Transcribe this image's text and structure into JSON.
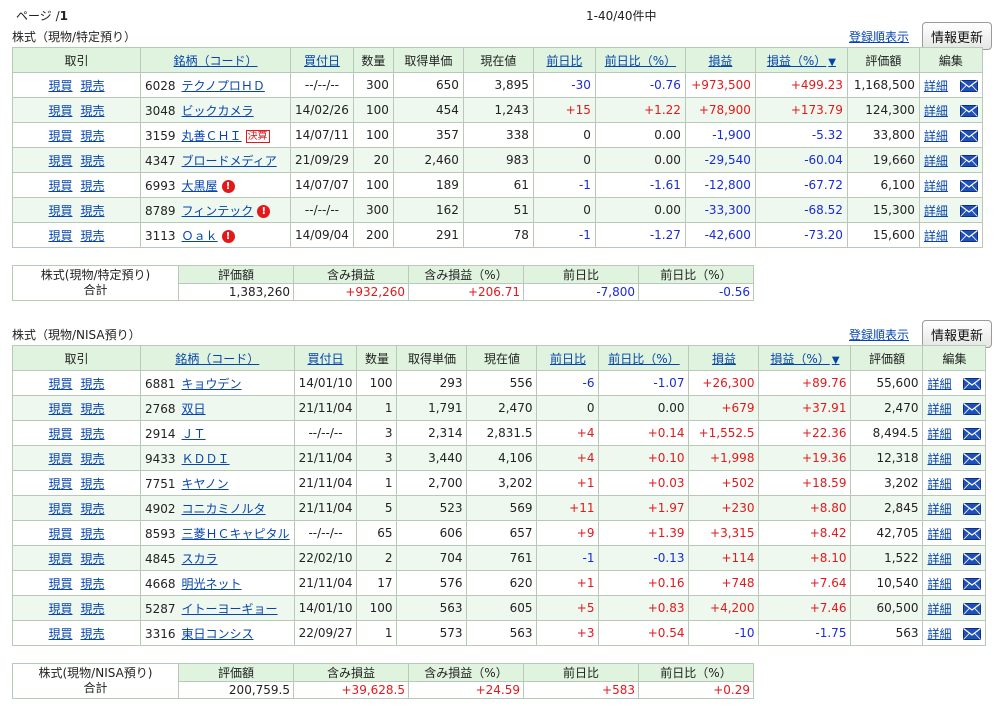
{
  "page": {
    "label": "ページ /",
    "number": "1"
  },
  "counter": "1-40/40件中",
  "header": {
    "trade": "取引",
    "name": "銘柄（コード）",
    "date": "買付日",
    "qty": "数量",
    "cost": "取得単価",
    "price": "現在値",
    "dayChange": "前日比",
    "dayChangePct": "前日比（%）",
    "pl": "損益",
    "plPct": "損益（%）",
    "plPctArrow": "▼",
    "value": "評価額",
    "edit": "編集"
  },
  "tradeLabels": {
    "buy": "現買",
    "sell": "現売"
  },
  "detailLabel": "詳細",
  "sortLinkLabel": "登録順表示",
  "refreshLabel": "情報更新",
  "sections": [
    {
      "title": "株式（現物/特定預り）",
      "rows": [
        {
          "code": "6028",
          "name": "テクノプロＨＤ",
          "badge": "",
          "date": "--/--/--",
          "qty": "300",
          "cost": "650",
          "price": "3,895",
          "dc": "-30",
          "dcp": "-0.76",
          "pl": "+973,500",
          "plp": "+499.23",
          "value": "1,168,500"
        },
        {
          "code": "3048",
          "name": "ビックカメラ",
          "badge": "",
          "date": "14/02/26",
          "qty": "100",
          "cost": "454",
          "price": "1,243",
          "dc": "+15",
          "dcp": "+1.22",
          "pl": "+78,900",
          "plp": "+173.79",
          "value": "124,300"
        },
        {
          "code": "3159",
          "name": "丸善ＣＨＩ",
          "badge": "決算",
          "date": "14/07/11",
          "qty": "100",
          "cost": "357",
          "price": "338",
          "dc": "0",
          "dcp": "0.00",
          "pl": "-1,900",
          "plp": "-5.32",
          "value": "33,800"
        },
        {
          "code": "4347",
          "name": "ブロードメディア",
          "badge": "",
          "date": "21/09/29",
          "qty": "20",
          "cost": "2,460",
          "price": "983",
          "dc": "0",
          "dcp": "0.00",
          "pl": "-29,540",
          "plp": "-60.04",
          "value": "19,660"
        },
        {
          "code": "6993",
          "name": "大黒屋",
          "badge": "!",
          "date": "14/07/07",
          "qty": "100",
          "cost": "189",
          "price": "61",
          "dc": "-1",
          "dcp": "-1.61",
          "pl": "-12,800",
          "plp": "-67.72",
          "value": "6,100"
        },
        {
          "code": "8789",
          "name": "フィンテック",
          "badge": "!",
          "date": "--/--/--",
          "qty": "300",
          "cost": "162",
          "price": "51",
          "dc": "0",
          "dcp": "0.00",
          "pl": "-33,300",
          "plp": "-68.52",
          "value": "15,300"
        },
        {
          "code": "3113",
          "name": "Ｏａｋ",
          "badge": "!",
          "date": "14/09/04",
          "qty": "200",
          "cost": "291",
          "price": "78",
          "dc": "-1",
          "dcp": "-1.27",
          "pl": "-42,600",
          "plp": "-73.20",
          "value": "15,600"
        }
      ],
      "summary": {
        "label1": "株式(現物/特定預り)",
        "label2": "合計",
        "headers": [
          "評価額",
          "含み損益",
          "含み損益（%）",
          "前日比",
          "前日比（%）"
        ],
        "values": [
          "1,383,260",
          "+932,260",
          "+206.71",
          "-7,800",
          "-0.56"
        ]
      }
    },
    {
      "title": "株式（現物/NISA預り）",
      "rows": [
        {
          "code": "6881",
          "name": "キョウデン",
          "badge": "",
          "date": "14/01/10",
          "qty": "100",
          "cost": "293",
          "price": "556",
          "dc": "-6",
          "dcp": "-1.07",
          "pl": "+26,300",
          "plp": "+89.76",
          "value": "55,600"
        },
        {
          "code": "2768",
          "name": "双日",
          "badge": "",
          "date": "21/11/04",
          "qty": "1",
          "cost": "1,791",
          "price": "2,470",
          "dc": "0",
          "dcp": "0.00",
          "pl": "+679",
          "plp": "+37.91",
          "value": "2,470"
        },
        {
          "code": "2914",
          "name": "ＪＴ",
          "badge": "",
          "date": "--/--/--",
          "qty": "3",
          "cost": "2,314",
          "price": "2,831.5",
          "dc": "+4",
          "dcp": "+0.14",
          "pl": "+1,552.5",
          "plp": "+22.36",
          "value": "8,494.5"
        },
        {
          "code": "9433",
          "name": "ＫＤＤＩ",
          "badge": "",
          "date": "21/11/04",
          "qty": "3",
          "cost": "3,440",
          "price": "4,106",
          "dc": "+4",
          "dcp": "+0.10",
          "pl": "+1,998",
          "plp": "+19.36",
          "value": "12,318"
        },
        {
          "code": "7751",
          "name": "キヤノン",
          "badge": "",
          "date": "21/11/04",
          "qty": "1",
          "cost": "2,700",
          "price": "3,202",
          "dc": "+1",
          "dcp": "+0.03",
          "pl": "+502",
          "plp": "+18.59",
          "value": "3,202"
        },
        {
          "code": "4902",
          "name": "コニカミノルタ",
          "badge": "",
          "date": "21/11/04",
          "qty": "5",
          "cost": "523",
          "price": "569",
          "dc": "+11",
          "dcp": "+1.97",
          "pl": "+230",
          "plp": "+8.80",
          "value": "2,845"
        },
        {
          "code": "8593",
          "name": "三菱ＨＣキャピタル",
          "badge": "",
          "date": "--/--/--",
          "qty": "65",
          "cost": "606",
          "price": "657",
          "dc": "+9",
          "dcp": "+1.39",
          "pl": "+3,315",
          "plp": "+8.42",
          "value": "42,705"
        },
        {
          "code": "4845",
          "name": "スカラ",
          "badge": "",
          "date": "22/02/10",
          "qty": "2",
          "cost": "704",
          "price": "761",
          "dc": "-1",
          "dcp": "-0.13",
          "pl": "+114",
          "plp": "+8.10",
          "value": "1,522"
        },
        {
          "code": "4668",
          "name": "明光ネット",
          "badge": "",
          "date": "21/11/04",
          "qty": "17",
          "cost": "576",
          "price": "620",
          "dc": "+1",
          "dcp": "+0.16",
          "pl": "+748",
          "plp": "+7.64",
          "value": "10,540"
        },
        {
          "code": "5287",
          "name": "イトーヨーギョー",
          "badge": "",
          "date": "14/01/10",
          "qty": "100",
          "cost": "563",
          "price": "605",
          "dc": "+5",
          "dcp": "+0.83",
          "pl": "+4,200",
          "plp": "+7.46",
          "value": "60,500"
        },
        {
          "code": "3316",
          "name": "東日コンシス",
          "badge": "",
          "date": "22/09/27",
          "qty": "1",
          "cost": "573",
          "price": "563",
          "dc": "+3",
          "dcp": "+0.54",
          "pl": "-10",
          "plp": "-1.75",
          "value": "563"
        }
      ],
      "summary": {
        "label1": "株式(現物/NISA預り)",
        "label2": "合計",
        "headers": [
          "評価額",
          "含み損益",
          "含み損益（%）",
          "前日比",
          "前日比（%）"
        ],
        "values": [
          "200,759.5",
          "+39,628.5",
          "+24.59",
          "+583",
          "+0.29"
        ]
      }
    }
  ],
  "colors": {
    "positive": "#e0191b",
    "negative": "#1a2bd6",
    "header_bg": "#dff3df",
    "row_alt_bg": "#eef8ee",
    "link": "#0645ad"
  },
  "icons": {
    "mail": "mail-icon",
    "warning": "warning-icon"
  }
}
